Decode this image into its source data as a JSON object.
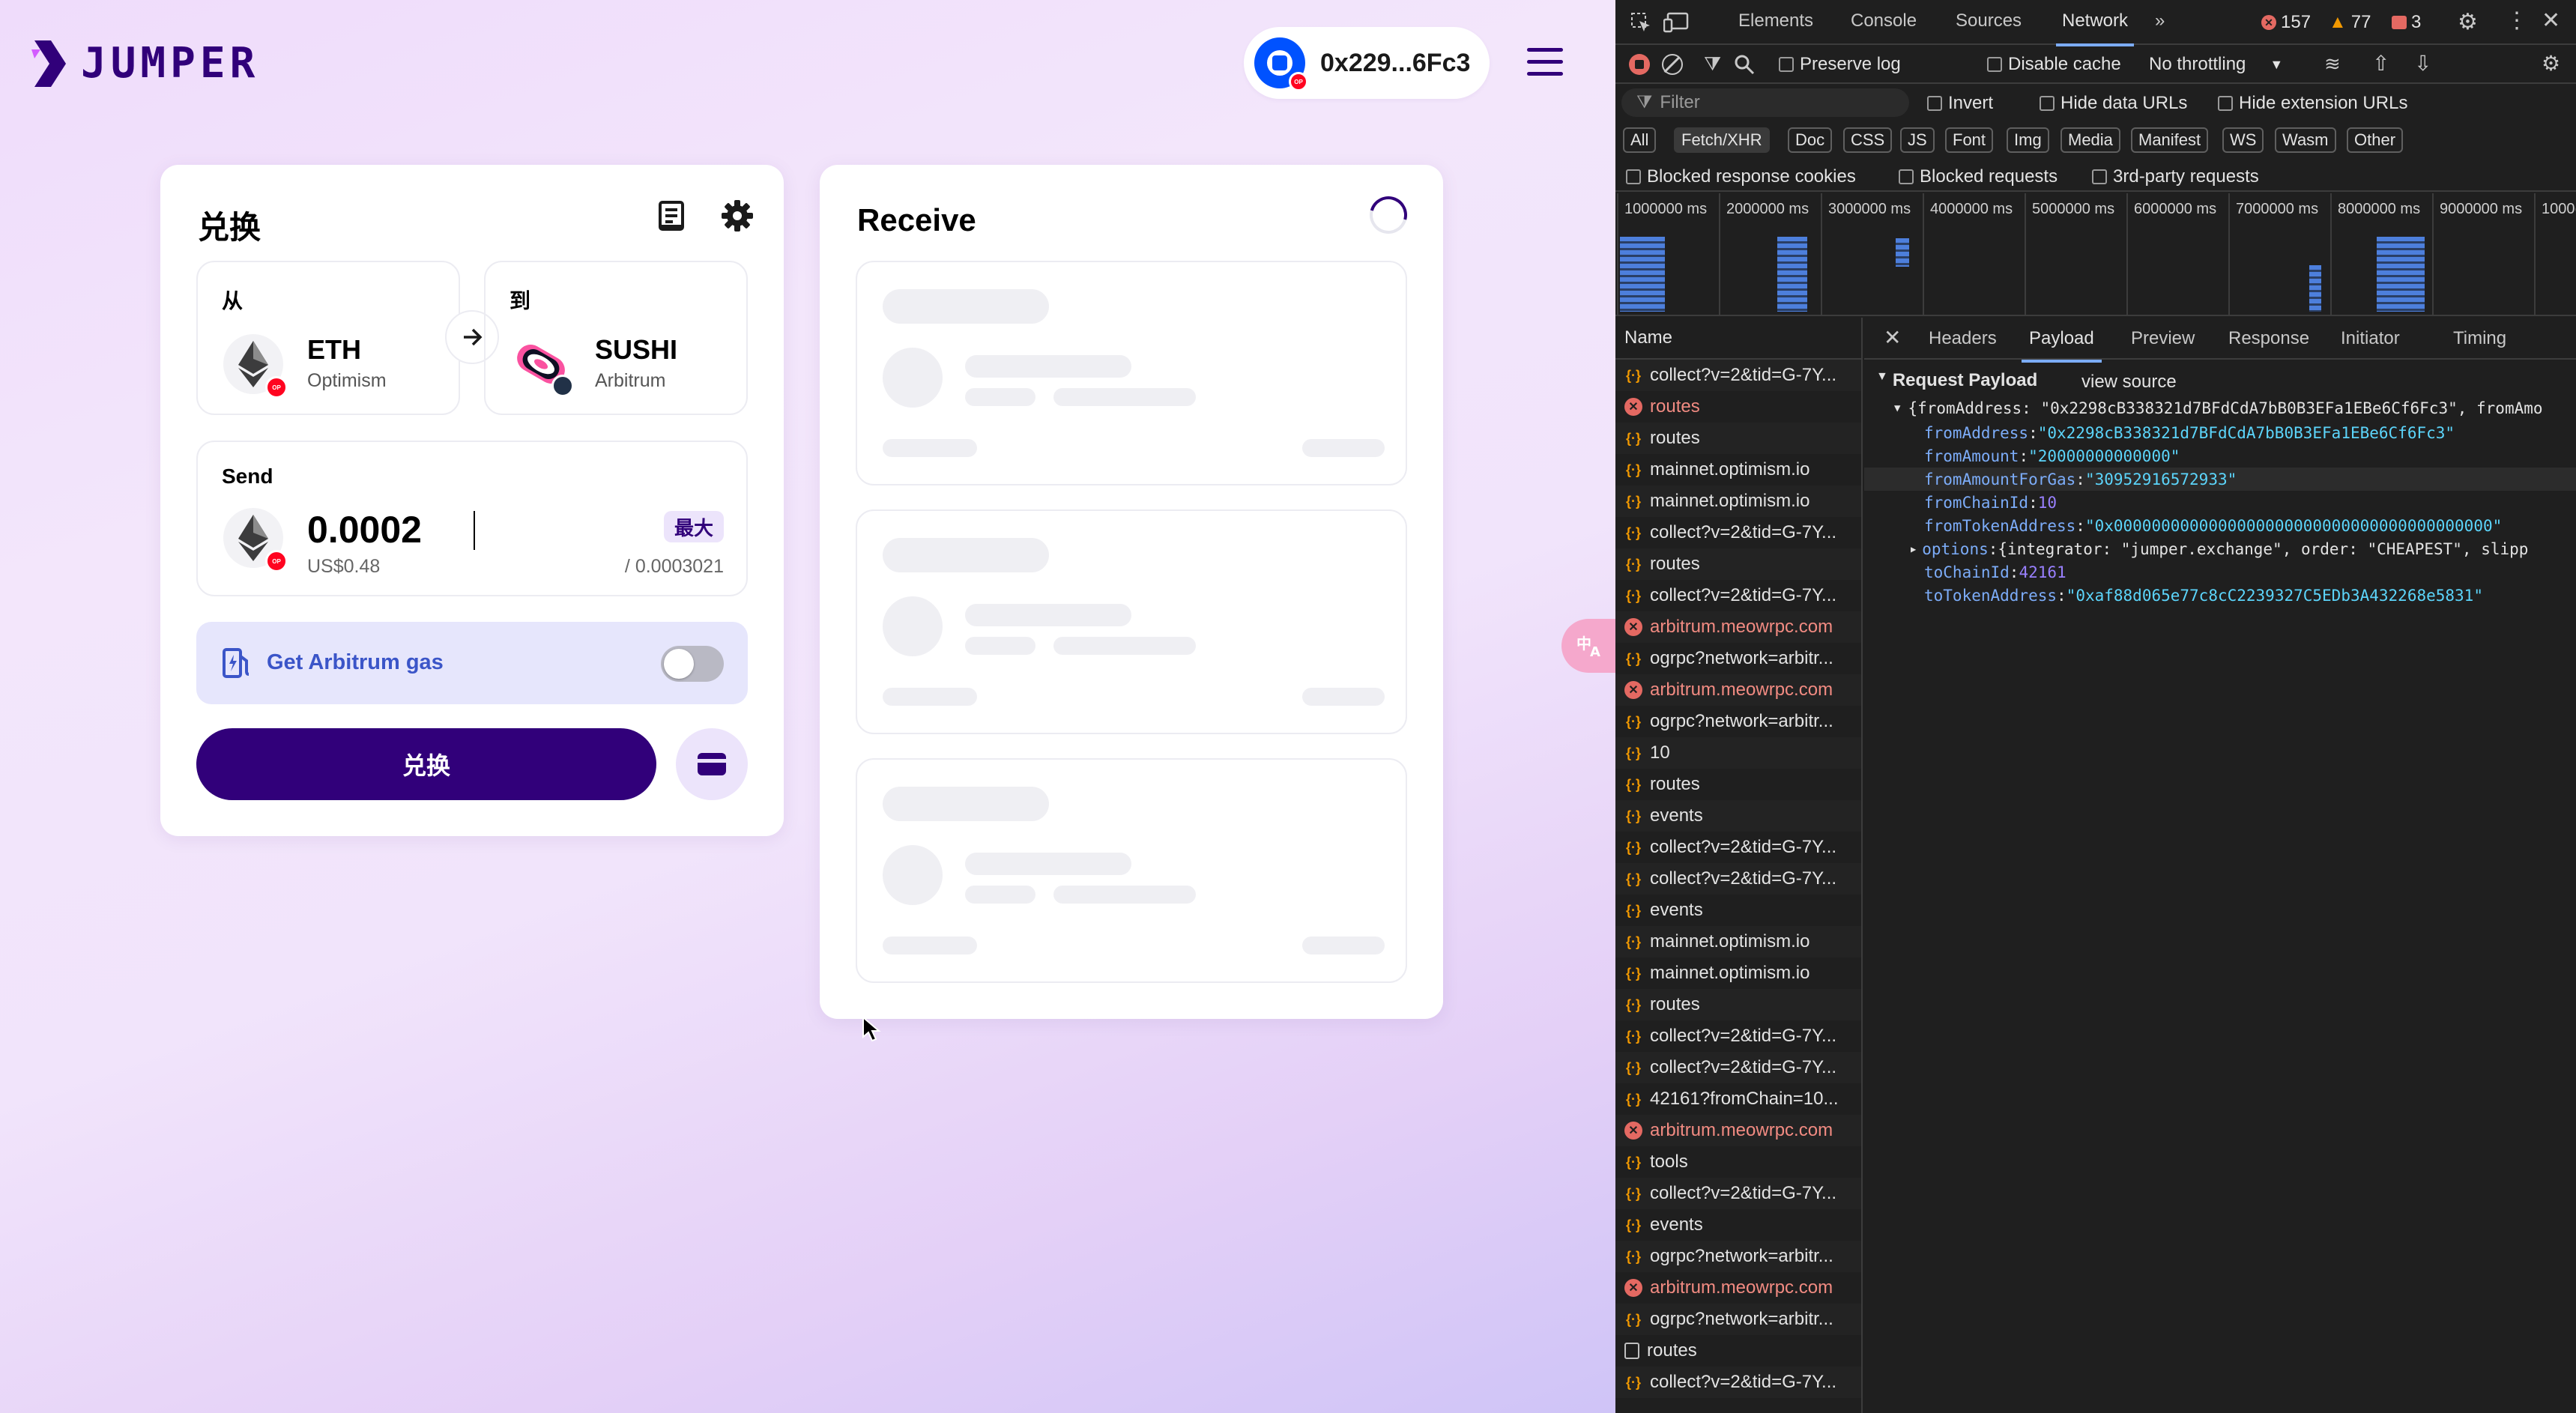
{
  "app": {
    "logo_text": "JUMPER",
    "wallet_address": "0x229...6Fc3",
    "swap_card": {
      "title": "兑换",
      "from": {
        "label": "从",
        "symbol": "ETH",
        "chain": "Optimism"
      },
      "to": {
        "label": "到",
        "symbol": "SUSHI",
        "chain": "Arbitrum"
      },
      "send": {
        "label": "Send",
        "amount": "0.0002",
        "usd": "US$0.48",
        "max_label": "最大",
        "balance": "/ 0.0003021"
      },
      "gas": {
        "label": "Get Arbitrum gas",
        "enabled": false
      },
      "swap_button": "兑换"
    },
    "receive_card": {
      "title": "Receive"
    },
    "colors": {
      "brand": "#31007a",
      "gas_text": "#3b55c8",
      "op_red": "#ff0420"
    }
  },
  "devtools": {
    "tabs": [
      "Elements",
      "Console",
      "Sources",
      "Network"
    ],
    "active_tab": "Network",
    "errors": "157",
    "warnings": "77",
    "issues": "3",
    "toolbar": {
      "preserve_log": "Preserve log",
      "disable_cache": "Disable cache",
      "throttling": "No throttling"
    },
    "filter_placeholder": "Filter",
    "invert": "Invert",
    "hide_data_urls": "Hide data URLs",
    "hide_extension_urls": "Hide extension URLs",
    "types": [
      "All",
      "Fetch/XHR",
      "Doc",
      "CSS",
      "JS",
      "Font",
      "Img",
      "Media",
      "Manifest",
      "WS",
      "Wasm",
      "Other"
    ],
    "active_type": "Fetch/XHR",
    "blocked_cookies": "Blocked response cookies",
    "blocked_requests": "Blocked requests",
    "third_party": "3rd-party requests",
    "timeline_labels": [
      "1000000 ms",
      "2000000 ms",
      "3000000 ms",
      "4000000 ms",
      "5000000 ms",
      "6000000 ms",
      "7000000 ms",
      "8000000 ms",
      "9000000 ms",
      "1000("
    ],
    "name_header": "Name",
    "requests": [
      {
        "name": "collect?v=2&tid=G-7Y...",
        "type": "fetch"
      },
      {
        "name": "routes",
        "type": "error"
      },
      {
        "name": "routes",
        "type": "fetch"
      },
      {
        "name": "mainnet.optimism.io",
        "type": "fetch"
      },
      {
        "name": "mainnet.optimism.io",
        "type": "fetch"
      },
      {
        "name": "collect?v=2&tid=G-7Y...",
        "type": "fetch"
      },
      {
        "name": "routes",
        "type": "fetch"
      },
      {
        "name": "collect?v=2&tid=G-7Y...",
        "type": "fetch"
      },
      {
        "name": "arbitrum.meowrpc.com",
        "type": "error"
      },
      {
        "name": "ogrpc?network=arbitr...",
        "type": "fetch"
      },
      {
        "name": "arbitrum.meowrpc.com",
        "type": "error"
      },
      {
        "name": "ogrpc?network=arbitr...",
        "type": "fetch"
      },
      {
        "name": "10",
        "type": "fetch"
      },
      {
        "name": "routes",
        "type": "fetch"
      },
      {
        "name": "events",
        "type": "fetch"
      },
      {
        "name": "collect?v=2&tid=G-7Y...",
        "type": "fetch"
      },
      {
        "name": "collect?v=2&tid=G-7Y...",
        "type": "fetch"
      },
      {
        "name": "events",
        "type": "fetch"
      },
      {
        "name": "mainnet.optimism.io",
        "type": "fetch"
      },
      {
        "name": "mainnet.optimism.io",
        "type": "fetch"
      },
      {
        "name": "routes",
        "type": "fetch"
      },
      {
        "name": "collect?v=2&tid=G-7Y...",
        "type": "fetch"
      },
      {
        "name": "collect?v=2&tid=G-7Y...",
        "type": "fetch"
      },
      {
        "name": "42161?fromChain=10...",
        "type": "fetch"
      },
      {
        "name": "arbitrum.meowrpc.com",
        "type": "error"
      },
      {
        "name": "tools",
        "type": "fetch"
      },
      {
        "name": "collect?v=2&tid=G-7Y...",
        "type": "fetch"
      },
      {
        "name": "events",
        "type": "fetch"
      },
      {
        "name": "ogrpc?network=arbitr...",
        "type": "fetch"
      },
      {
        "name": "arbitrum.meowrpc.com",
        "type": "error"
      },
      {
        "name": "ogrpc?network=arbitr...",
        "type": "fetch"
      },
      {
        "name": "routes",
        "type": "doc"
      },
      {
        "name": "collect?v=2&tid=G-7Y...",
        "type": "fetch"
      }
    ],
    "detail_tabs": [
      "Headers",
      "Payload",
      "Preview",
      "Response",
      "Initiator",
      "Timing"
    ],
    "active_detail_tab": "Payload",
    "payload": {
      "title": "Request Payload",
      "view_source": "view source",
      "summary": "{fromAddress: \"0x2298cB338321d7BFdCdA7bB0B3EFa1EBe6Cf6Fc3\", fromAmo",
      "fields": [
        {
          "key": "fromAddress",
          "value": "\"0x2298cB338321d7BFdCdA7bB0B3EFa1EBe6Cf6Fc3\"",
          "kind": "str"
        },
        {
          "key": "fromAmount",
          "value": "\"20000000000000\"",
          "kind": "str"
        },
        {
          "key": "fromAmountForGas",
          "value": "\"30952916572933\"",
          "kind": "str"
        },
        {
          "key": "fromChainId",
          "value": "10",
          "kind": "num"
        },
        {
          "key": "fromTokenAddress",
          "value": "\"0x0000000000000000000000000000000000000000\"",
          "kind": "str"
        },
        {
          "key": "options",
          "value": "{integrator: \"jumper.exchange\", order: \"CHEAPEST\", slipp",
          "kind": "plain"
        },
        {
          "key": "toChainId",
          "value": "42161",
          "kind": "num"
        },
        {
          "key": "toTokenAddress",
          "value": "\"0xaf88d065e77c8cC2239327C5EDb3A432268e5831\"",
          "kind": "str"
        }
      ]
    }
  }
}
